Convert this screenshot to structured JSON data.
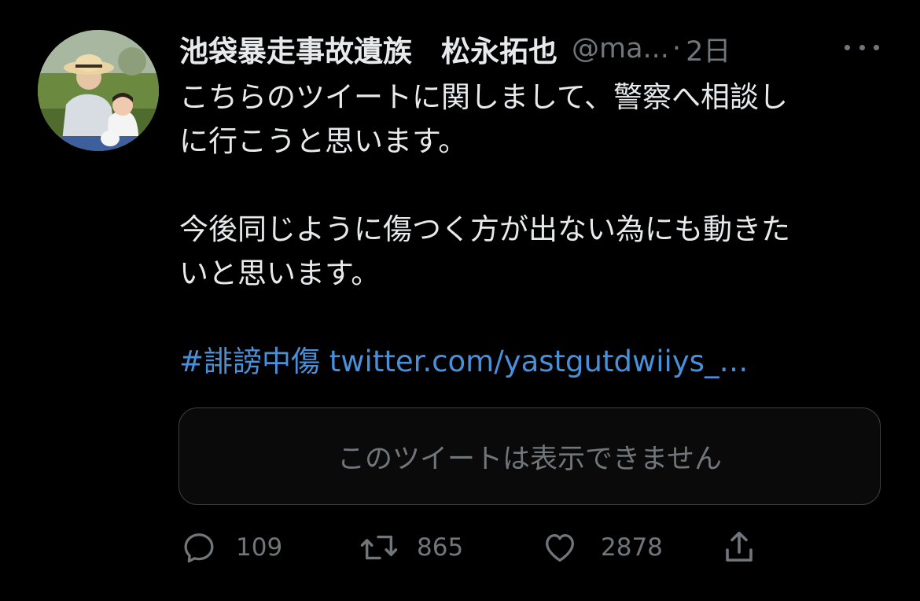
{
  "tweet": {
    "display_name": "池袋暴走事故遺族　松永拓也",
    "handle": "@ma...",
    "separator": "·",
    "time": "2日",
    "body_lines": [
      "こちらのツイートに関しまして、警察へ相談し",
      "に行こうと思います。",
      "今後同じように傷つく方が出ない為にも動きた",
      "いと思います。"
    ],
    "hashtag": "#誹謗中傷",
    "link": "twitter.com/yastgutdwiiys_…",
    "quoted_unavailable": "このツイートは表示できません"
  },
  "actions": {
    "reply_count": "109",
    "retweet_count": "865",
    "like_count": "2878"
  },
  "icons": {
    "reply": "reply-icon",
    "retweet": "retweet-icon",
    "like": "heart-icon",
    "share": "share-icon",
    "more": "more-icon"
  },
  "colors": {
    "background": "#000000",
    "text": "#e7e9ea",
    "secondary": "#71767b",
    "link": "#4a90d9",
    "border": "#3e4144"
  }
}
